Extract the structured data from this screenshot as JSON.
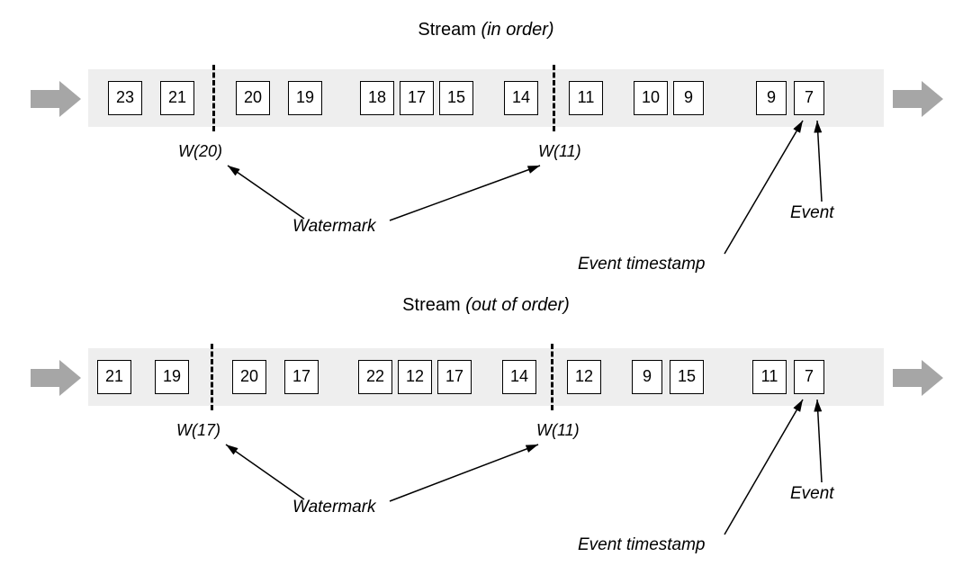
{
  "titles": {
    "top_normal": "Stream ",
    "top_italic": "(in order)",
    "bottom_normal": "Stream ",
    "bottom_italic": "(out of order)"
  },
  "streams": {
    "in_order": {
      "events": [
        "23",
        "21",
        "20",
        "19",
        "18",
        "17",
        "15",
        "14",
        "11",
        "10",
        "9",
        "9",
        "7"
      ],
      "watermark_labels": {
        "left": "W(20)",
        "right": "W(11)"
      }
    },
    "out_of_order": {
      "events": [
        "21",
        "19",
        "20",
        "17",
        "22",
        "12",
        "17",
        "14",
        "12",
        "9",
        "15",
        "11",
        "7"
      ],
      "watermark_labels": {
        "left": "W(17)",
        "right": "W(11)"
      }
    }
  },
  "annotations": {
    "watermark": "Watermark",
    "event": "Event",
    "event_timestamp": "Event timestamp"
  }
}
